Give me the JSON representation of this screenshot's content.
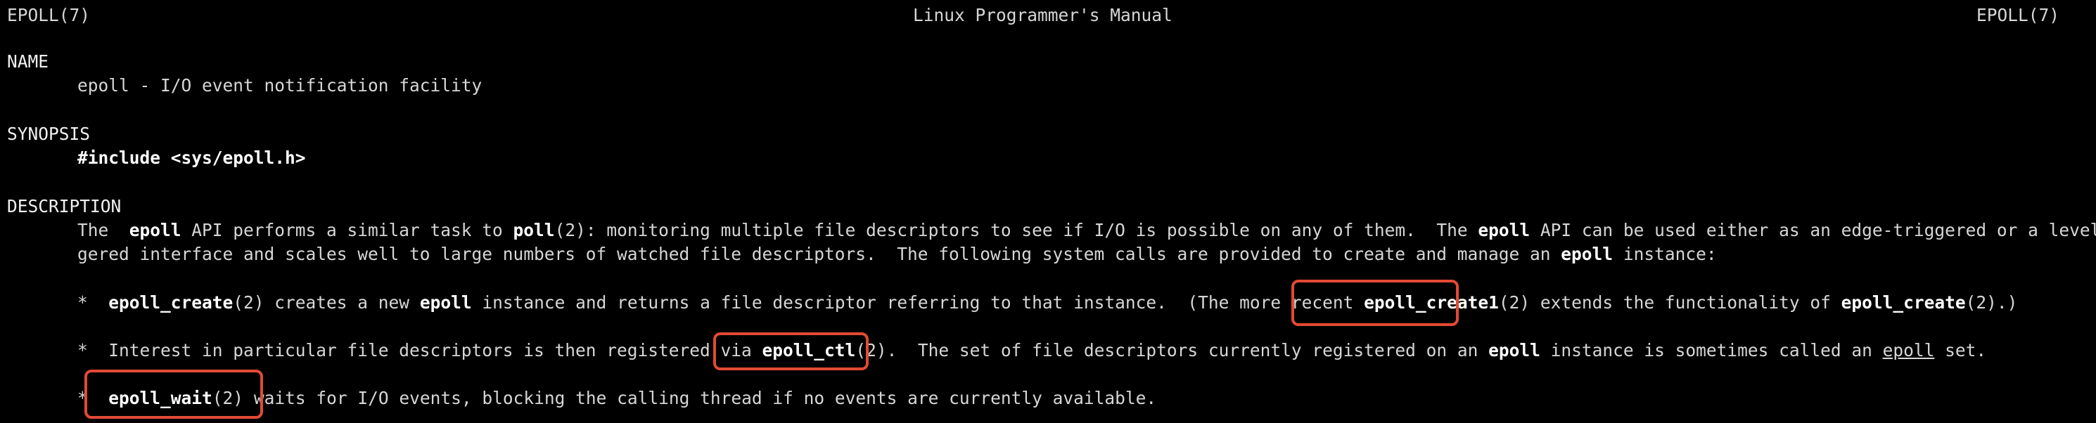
{
  "header": {
    "left": "EPOLL(7)",
    "center": "Linux Programmer's Manual",
    "right": "EPOLL(7)"
  },
  "name_section": {
    "heading": "NAME",
    "text": "epoll - I/O event notification facility"
  },
  "synopsis_section": {
    "heading": "SYNOPSIS",
    "include": "#include <sys/epoll.h>"
  },
  "description_section": {
    "heading": "DESCRIPTION",
    "p1_a": "The  ",
    "p1_b": "epoll",
    "p1_c": " API performs a similar task to ",
    "p1_d": "poll",
    "p1_e": "(2): monitoring multiple file descriptors to see if I/O is possible on any of them.  The ",
    "p1_f": "epoll",
    "p1_g": " API can be used either as an edge-triggered or a level-trig-",
    "p2_a": "gered interface and scales well to large numbers of watched file descriptors.  The following system calls are provided to create and manage an ",
    "p2_b": "epoll",
    "p2_c": " instance:",
    "bullet1": {
      "marker": "*",
      "a": "epoll_create",
      "b": "(2) creates a new ",
      "c": "epoll",
      "d": " instance and returns a file descriptor referring to that instance.  (The more recent ",
      "e": "epoll_create1",
      "f": "(2)",
      "g": " extends the functionality of ",
      "h": "epoll_create",
      "i": "(2).)"
    },
    "bullet2": {
      "marker": "*",
      "a": "Interest in particular file descriptors is then registered via ",
      "b": "epoll_ctl",
      "c": "(2).",
      "d": "  The set of file descriptors currently registered on an ",
      "e": "epoll",
      "f": " instance is sometimes called an ",
      "g": "epoll",
      "h": " ",
      "i": "set",
      "j": "."
    },
    "bullet3": {
      "marker": "*",
      "a": "epoll_wait",
      "b": "(2)",
      "c": " waits for I/O events, blocking the calling thread if no events are currently available."
    }
  },
  "highlight_color": "#e24a33"
}
